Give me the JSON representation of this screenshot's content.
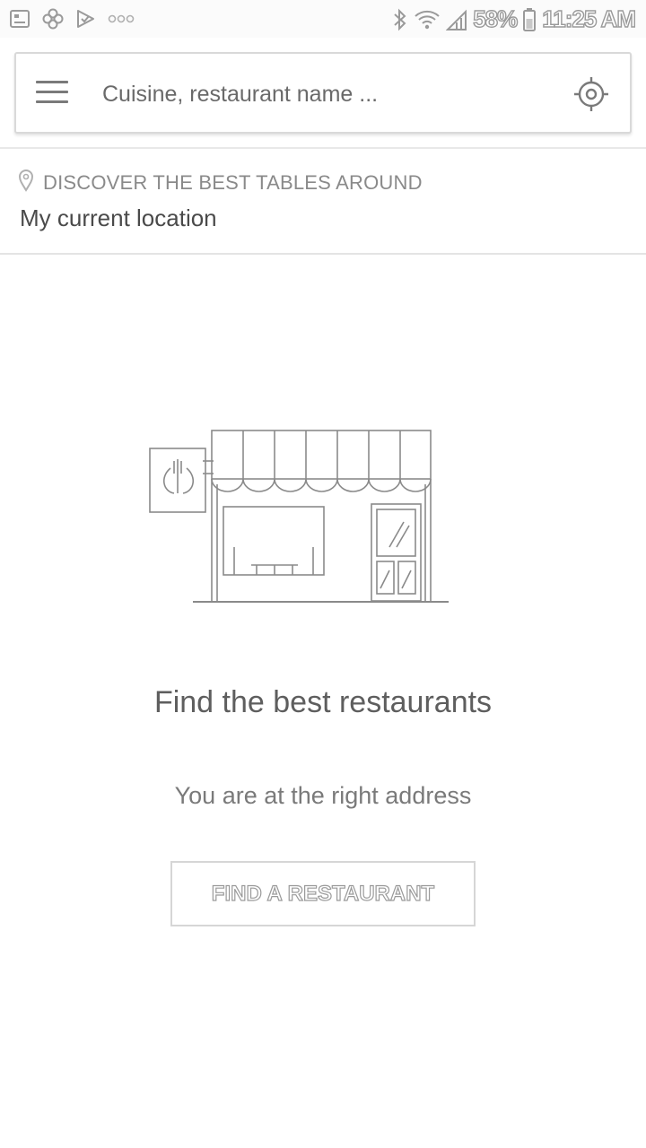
{
  "status_bar": {
    "battery": "58%",
    "time": "11:25 AM",
    "left_icons": [
      "image-notification-icon",
      "pinwheel-icon",
      "checkmark-flag-icon",
      "more-dots-icon"
    ],
    "right_icons": [
      "bluetooth-icon",
      "wifi-icon",
      "signal-icon",
      "battery-icon"
    ]
  },
  "search": {
    "placeholder": "Cuisine, restaurant name ..."
  },
  "location": {
    "heading": "DISCOVER THE BEST TABLES AROUND",
    "value": "My current location"
  },
  "empty_state": {
    "title": "Find the best restaurants",
    "subtitle": "You are at the right address",
    "button_label": "FIND A RESTAURANT"
  },
  "colors": {
    "background": "#ffffff",
    "stroke": "#8a8a8a",
    "text_primary": "#4a4a4a",
    "text_secondary": "#8a8a8a"
  }
}
